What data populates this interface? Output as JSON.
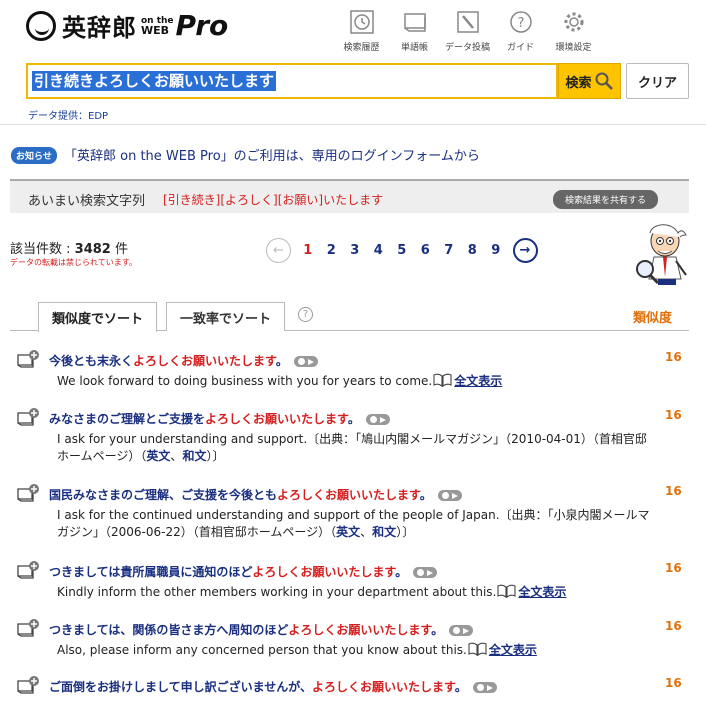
{
  "header": {
    "logo_text": "英辞郎",
    "logo_small_top": "on the",
    "logo_small_bottom": "WEB",
    "logo_pro": "Pro",
    "nav": [
      {
        "label": "検索履歴",
        "icon": "clock-icon"
      },
      {
        "label": "単語帳",
        "icon": "wordbook-icon"
      },
      {
        "label": "データ投稿",
        "icon": "pencil-icon"
      },
      {
        "label": "ガイド",
        "icon": "help-icon"
      },
      {
        "label": "環境設定",
        "icon": "gear-icon"
      }
    ]
  },
  "search": {
    "query": "引き続きよろしくお願いいたします",
    "search_label": "検索",
    "clear_label": "クリア",
    "data_provider": "データ提供：EDP"
  },
  "notice": {
    "badge": "お知らせ",
    "text": "「英辞郎 on the WEB Pro」のご利用は、専用のログインフォームから"
  },
  "fuzzy": {
    "label": "あいまい検索文字列",
    "terms": "[引き続き][よろしく][お願い]いたします",
    "share_label": "検索結果を共有する"
  },
  "results_meta": {
    "count_label": "該当件数 : ",
    "count": "3482",
    "count_unit": " 件",
    "reprint_note": "データの転載は禁じられています。",
    "pages": [
      "1",
      "2",
      "3",
      "4",
      "5",
      "6",
      "7",
      "8",
      "9"
    ],
    "current_page": "1"
  },
  "tabs": {
    "similarity": "類似度でソート",
    "match_rate": "一致率でソート",
    "help": "?",
    "column_header": "類似度"
  },
  "results": [
    {
      "jp_pre": "今後とも末永く",
      "jp_hl": "よろしくお願いいたします",
      "jp_post": "。",
      "en": "We look forward to doing business with you for years to come.",
      "full_label": "全文表示",
      "score": "16"
    },
    {
      "jp_pre": "みなさまのご理解とご支援を",
      "jp_hl": "よろしくお願いいたします",
      "jp_post": "。",
      "en": "I ask for your understanding and support.〔出典：「鳩山内閣メールマガジン」（2010-04-01）（首相官邸ホームページ）（",
      "src_links": [
        "英文",
        "和文"
      ],
      "en_tail": "）〕",
      "score": "16"
    },
    {
      "jp_pre": "国民みなさまのご理解、ご支援を今後とも",
      "jp_hl": "よろしくお願いいたします",
      "jp_post": "。",
      "en": "I ask for the continued understanding and support of the people of Japan.〔出典：「小泉内閣メールマガジン」（2006-06-22）（首相官邸ホームページ）（",
      "src_links": [
        "英文",
        "和文"
      ],
      "en_tail": "）〕",
      "score": "16"
    },
    {
      "jp_pre": "つきましては貴所属職員に通知のほど",
      "jp_hl": "よろしくお願いいたします",
      "jp_post": "。",
      "en": "Kindly inform the other members working in your department about this.",
      "full_label": "全文表示",
      "score": "16"
    },
    {
      "jp_pre": "つきましては、関係の皆さま方へ周知のほど",
      "jp_hl": "よろしくお願いいたします",
      "jp_post": "。",
      "en": "Also, please inform any concerned person that you know about this.",
      "full_label": "全文表示",
      "score": "16"
    },
    {
      "jp_pre": "ご面倒をお掛けしまして申し訳ございませんが、",
      "jp_hl": "よろしくお願いいたします",
      "jp_post": "。",
      "score": "16"
    }
  ],
  "colors": {
    "accent_yellow": "#ffc400",
    "navy": "#1a2f80",
    "highlight_red": "#d42020",
    "score_orange": "#e0700a"
  }
}
